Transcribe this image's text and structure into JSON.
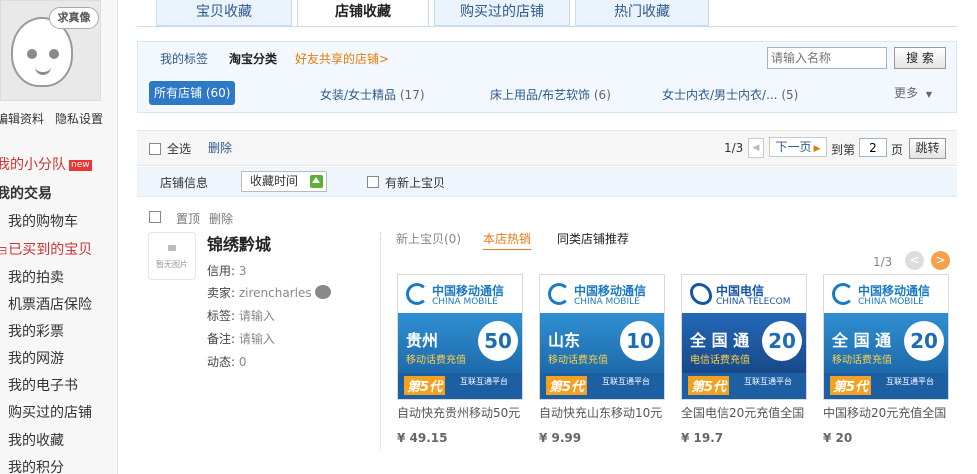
{
  "sidebar": {
    "avatar_caption": "求真像",
    "edit_profile": "编辑资料",
    "privacy": "隐私设置",
    "team": "我的小分队",
    "new_badge": "new",
    "trade_header": "我的交易",
    "items": [
      "我的购物车",
      "已买到的宝贝",
      "我的拍卖",
      "机票酒店保险",
      "我的彩票",
      "我的网游",
      "我的电子书",
      "购买过的店铺",
      "我的收藏",
      "我的积分"
    ]
  },
  "tabs": [
    "宝贝收藏",
    "店铺收藏",
    "购买过的店铺",
    "热门收藏"
  ],
  "filter": {
    "my_tags": "我的标签",
    "taobao_category": "淘宝分类",
    "friends_shared": "好友共享的店铺>",
    "search_placeholder": "请输入名称",
    "search_button": "搜 索",
    "all_shops": "所有店铺 (60)",
    "categories": [
      {
        "name": "女装/女士精品",
        "count": "(17)"
      },
      {
        "name": "床上用品/布艺软饰",
        "count": "(6)"
      },
      {
        "name": "女士内衣/男士内衣/...",
        "count": "(5)"
      }
    ],
    "more": "更多"
  },
  "actions": {
    "select_all": "全选",
    "delete": "删除",
    "page_indicator": "1/3",
    "next_page": "下一页",
    "goto": "到第",
    "page_value": "2",
    "page_unit": "页",
    "jump": "跳转"
  },
  "sort": {
    "shop_info": "店铺信息",
    "collect_time": "收藏时间",
    "new_items": "有新上宝贝"
  },
  "shop": {
    "pin": "置顶",
    "delete": "删除",
    "logo_text": "暂无图片",
    "name": "锦绣黔城",
    "credit_label": "信用:",
    "credit_value": "3",
    "seller_label": "卖家:",
    "seller_value": "zirencharles",
    "tag_label": "标签:",
    "tag_value": "请输入",
    "note_label": "备注:",
    "note_value": "请输入",
    "activity_label": "动态:",
    "activity_value": "0",
    "subtabs": [
      "新上宝贝(0)",
      "本店热销",
      "同类店铺推荐"
    ],
    "pager": "1/3",
    "products": [
      {
        "brand_cn": "中国移动通信",
        "brand_en": "CHINA MOBILE",
        "prov": "贵州",
        "sub": "移动话费充值",
        "amount": "50",
        "platform": "互联互通平台",
        "g5": "第5代",
        "name": "自动快充贵州移动50元",
        "price": "¥ 49.15",
        "tele": false
      },
      {
        "brand_cn": "中国移动通信",
        "brand_en": "CHINA MOBILE",
        "prov": "山东",
        "sub": "移动话费充值",
        "amount": "10",
        "platform": "互联互通平台",
        "g5": "第5代",
        "name": "自动快充山东移动10元",
        "price": "¥ 9.99",
        "tele": false
      },
      {
        "brand_cn": "中国电信",
        "brand_en": "CHINA TELECOM",
        "prov": "全 国 通",
        "sub": "电信话费充值",
        "amount": "20",
        "platform": "互联互通平台",
        "g5": "第5代",
        "name": "全国电信20元充值全国",
        "price": "¥ 19.7",
        "tele": true
      },
      {
        "brand_cn": "中国移动通信",
        "brand_en": "CHINA MOBILE",
        "prov": "全 国 通",
        "sub": "移动话费充值",
        "amount": "20",
        "platform": "互联互通平台",
        "g5": "第5代",
        "name": "中国移动20元充值全国",
        "price": "¥ 20",
        "tele": false
      }
    ]
  },
  "colors": {
    "link_blue": "#2d5a8c",
    "orange": "#e87a0d",
    "accent": "#2e78c8"
  }
}
